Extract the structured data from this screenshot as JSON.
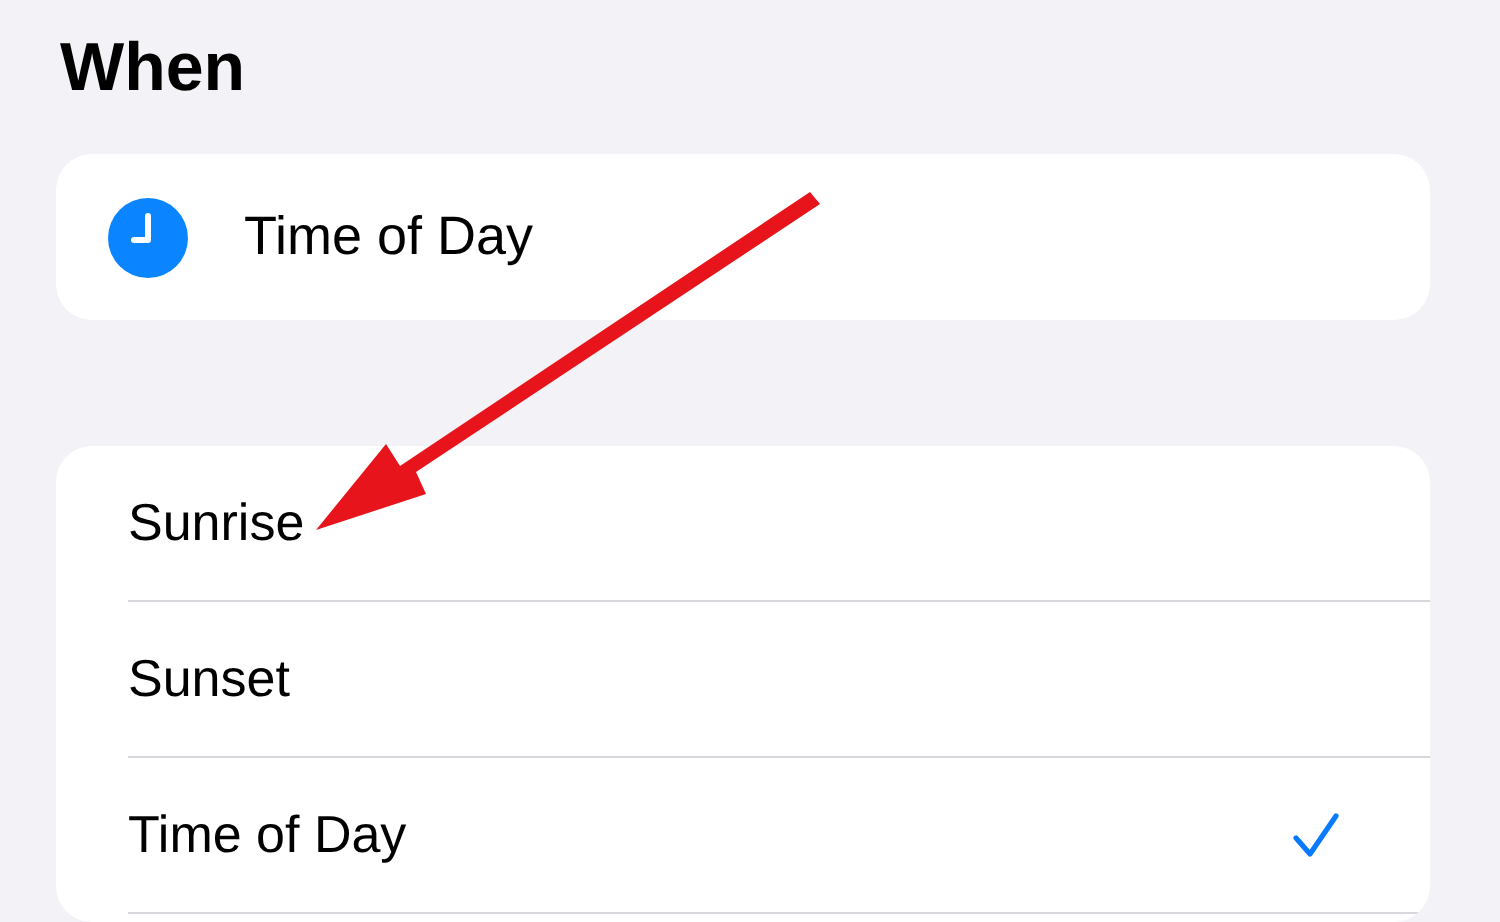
{
  "section_title": "When",
  "trigger": {
    "label": "Time of Day"
  },
  "options": [
    {
      "label": "Sunrise",
      "selected": false
    },
    {
      "label": "Sunset",
      "selected": false
    },
    {
      "label": "Time of Day",
      "selected": true
    }
  ]
}
